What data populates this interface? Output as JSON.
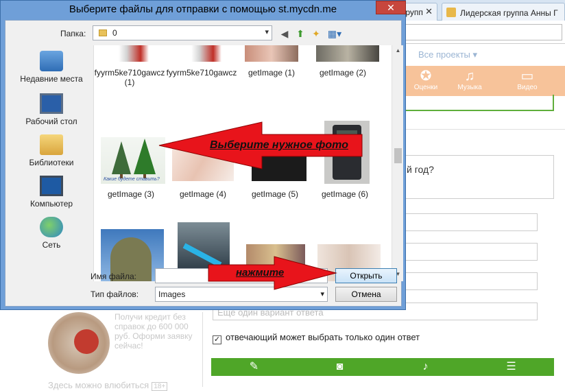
{
  "browser": {
    "tabs": [
      {
        "label": "групп"
      },
      {
        "label": "Лидерская группа Анны Г"
      }
    ],
    "projects_link": "Все проекты ▾",
    "nav_items": [
      {
        "icon": "star-icon",
        "label": "Оценки"
      },
      {
        "icon": "music-icon",
        "label": "Музыка"
      },
      {
        "icon": "video-icon",
        "label": "Видео"
      }
    ],
    "question_fragment": "й год?",
    "option_placeholder": "Еще один вариант ответа",
    "single_answer_label": "отвечающий может выбрать только один ответ",
    "ad_text": "Получи кредит без справок до 600 000 руб. Оформи заявку сейчас!",
    "ad_footer": "Здесь можно влюбиться",
    "ad_age": "18+"
  },
  "dialog": {
    "title": "Выберите файлы для отправки с помощью st.mycdn.me",
    "folder_label": "Папка:",
    "folder_value": "0",
    "places": [
      {
        "label": "Недавние места",
        "icon": "recent-places-icon"
      },
      {
        "label": "Рабочий стол",
        "icon": "desktop-icon"
      },
      {
        "label": "Библиотеки",
        "icon": "libraries-icon"
      },
      {
        "label": "Компьютер",
        "icon": "computer-icon"
      },
      {
        "label": "Сеть",
        "icon": "network-icon"
      }
    ],
    "files": [
      "fyyrm5ke710gawcz (1)",
      "fyyrm5ke710gawcz",
      "getImage (1)",
      "getImage (2)",
      "getImage (3)",
      "getImage (4)",
      "getImage (5)",
      "getImage (6)"
    ],
    "thumb_caption": "Какие будете ставить?",
    "filename_label": "Имя файла:",
    "filename_value": "",
    "filetype_label": "Тип файлов:",
    "filetype_value": "Images",
    "open_button": "Открыть",
    "cancel_button": "Отмена"
  },
  "annotations": {
    "choose_photo": "Выберите нужное фото",
    "press": "нажмите"
  },
  "colors": {
    "arrow_red": "#e8141b",
    "dialog_frame": "#6f9fd8",
    "close_button": "#c7463d",
    "green_toolbar": "#4fa628",
    "orange_nav": "#f7c39a"
  }
}
